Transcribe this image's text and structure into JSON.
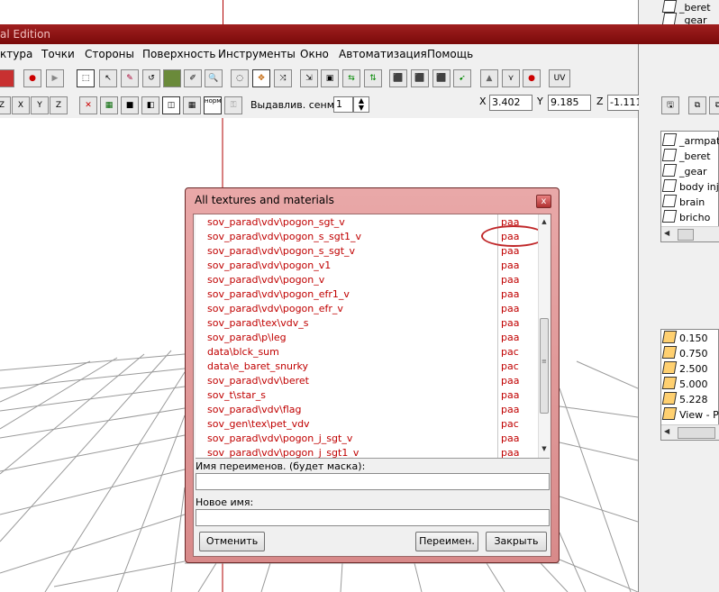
{
  "window": {
    "title_fragment": "al Edition"
  },
  "menu": [
    "ктура",
    "Точки",
    "Стороны",
    "Поверхность",
    "Инструменты",
    "Окно",
    "Автоматизация",
    "Помощь"
  ],
  "toolbar2": {
    "axis_buttons": [
      "Z",
      "X",
      "Y",
      "Z"
    ],
    "extrude_label": "Выдавлив. сенм.",
    "extrude_value": "1",
    "coords": {
      "x_label": "X",
      "x_value": "3.402",
      "y_label": "Y",
      "y_value": "9.185",
      "z_label": "Z",
      "z_value": "-1.111"
    },
    "uv_label": "UV",
    "norm_label": "норм"
  },
  "right_panel": {
    "top_items": [
      "_beret",
      "_gear"
    ],
    "list1_items": [
      "_armpatch",
      "_beret",
      "_gear",
      "body injury",
      "brain",
      "bricho"
    ],
    "list2_items": [
      "0.150",
      "0.750",
      "2.500",
      "5.000",
      "5.228",
      "View - Pil"
    ]
  },
  "dialog": {
    "title": "All textures and materials",
    "close_label": "x",
    "rows": [
      {
        "name": "sov_parad\\vdv\\pogon_sgt_v",
        "ext": "paa"
      },
      {
        "name": "sov_parad\\vdv\\pogon_s_sgt1_v",
        "ext": "paa"
      },
      {
        "name": "sov_parad\\vdv\\pogon_s_sgt_v",
        "ext": "paa"
      },
      {
        "name": "sov_parad\\vdv\\pogon_v1",
        "ext": "paa"
      },
      {
        "name": "sov_parad\\vdv\\pogon_v",
        "ext": "paa"
      },
      {
        "name": "sov_parad\\vdv\\pogon_efr1_v",
        "ext": "paa"
      },
      {
        "name": "sov_parad\\vdv\\pogon_efr_v",
        "ext": "paa"
      },
      {
        "name": "sov_parad\\tex\\vdv_s",
        "ext": "paa"
      },
      {
        "name": "sov_parad\\p\\leg",
        "ext": "paa"
      },
      {
        "name": "data\\blck_sum",
        "ext": "pac"
      },
      {
        "name": "data\\e_baret_snurky",
        "ext": "pac"
      },
      {
        "name": "sov_parad\\vdv\\beret",
        "ext": "paa"
      },
      {
        "name": "sov_t\\star_s",
        "ext": "paa"
      },
      {
        "name": "sov_parad\\vdv\\flag",
        "ext": "paa"
      },
      {
        "name": "sov_gen\\tex\\pet_vdv",
        "ext": "pac"
      },
      {
        "name": "sov_parad\\vdv\\pogon_j_sgt_v",
        "ext": "paa"
      },
      {
        "name": "sov_parad\\vdv\\pogon_j_sgt1_v",
        "ext": "paa"
      }
    ],
    "rename_mask_label": "Имя переименов. (будет маска):",
    "rename_mask_value": "",
    "new_name_label": "Новое имя:",
    "new_name_value": "",
    "cancel_button": "Отменить",
    "rename_button": "Переимен.",
    "close_button": "Закрыть"
  }
}
